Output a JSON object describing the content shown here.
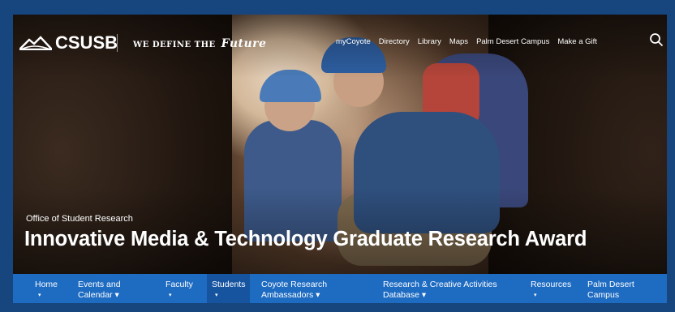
{
  "brand": {
    "name": "CSUSB",
    "tagline_prefix": "WE DEFINE THE",
    "tagline_script": "Future"
  },
  "top_nav": [
    "myCoyote",
    "Directory",
    "Library",
    "Maps",
    "Palm Desert Campus",
    "Make a Gift"
  ],
  "hero": {
    "eyebrow": "Office of Student Research",
    "title": "Innovative Media & Technology Graduate Research Award"
  },
  "bottom_nav": [
    {
      "line1": "Home",
      "line2": "▾"
    },
    {
      "line1": "Events and",
      "line2": "Calendar ▾"
    },
    {
      "line1": "Faculty",
      "line2": "▾"
    },
    {
      "line1": "Students",
      "line2": "▾"
    },
    {
      "line1": "Coyote Research",
      "line2": "Ambassadors ▾"
    },
    {
      "line1": "Research & Creative Activities",
      "line2": "Database ▾"
    },
    {
      "line1": "Resources",
      "line2": "▾"
    },
    {
      "line1": "Palm Desert",
      "line2": "Campus"
    }
  ],
  "colors": {
    "nav_bg": "#1e6bc2",
    "nav_active": "#1654a0",
    "frame": "#17457e"
  },
  "icons": {
    "search": "search-icon",
    "logo": "mountain-logo-icon"
  }
}
